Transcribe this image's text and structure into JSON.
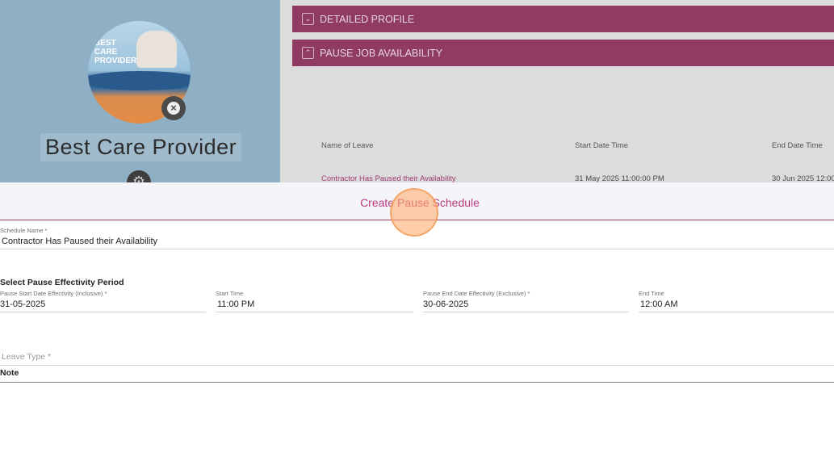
{
  "background": {
    "profile": {
      "name": "Best Care Provider",
      "avatar_text": "BEST CARE PROVIDER",
      "avatar_small_text": "",
      "remove_icon": "close-circle-icon",
      "settings_icon": "gear-icon"
    },
    "accordions": [
      {
        "label": "DETAILED PROFILE",
        "icon": "chevron-down-icon"
      },
      {
        "label": "PAUSE JOB AVAILABILITY",
        "icon": "chevron-up-icon"
      }
    ],
    "table": {
      "headers": [
        "Name of Leave",
        "Start Date Time",
        "End Date Time"
      ],
      "rows": [
        [
          "Contractor Has Paused their Availability",
          "31 May 2025 11:00:00 PM",
          "30 Jun 2025 12:00"
        ]
      ]
    },
    "colors": {
      "accent": "#8f3b62",
      "link": "#9c3a6c"
    }
  },
  "modal": {
    "title": "Create Pause Schedule",
    "schedule_name": {
      "label": "Schedule Name *",
      "value": "Contractor Has Paused their Availability"
    },
    "section_heading": "Select Pause Effectivity Period",
    "start_date": {
      "label": "Pause Start Date Effectivity (Inclusive) *",
      "value": "31-05-2025"
    },
    "start_time": {
      "label": "Start Time",
      "value": "11:00 PM"
    },
    "end_date": {
      "label": "Pause End Date Effectivity (Exclusive) *",
      "value": "30-06-2025"
    },
    "end_time": {
      "label": "End Time",
      "value": "12:00 AM"
    },
    "leave_type": {
      "placeholder": "Leave Type *"
    },
    "note": {
      "label": "Note"
    },
    "colors": {
      "title": "#b93d7f",
      "header_border": "#a43a6b"
    }
  }
}
